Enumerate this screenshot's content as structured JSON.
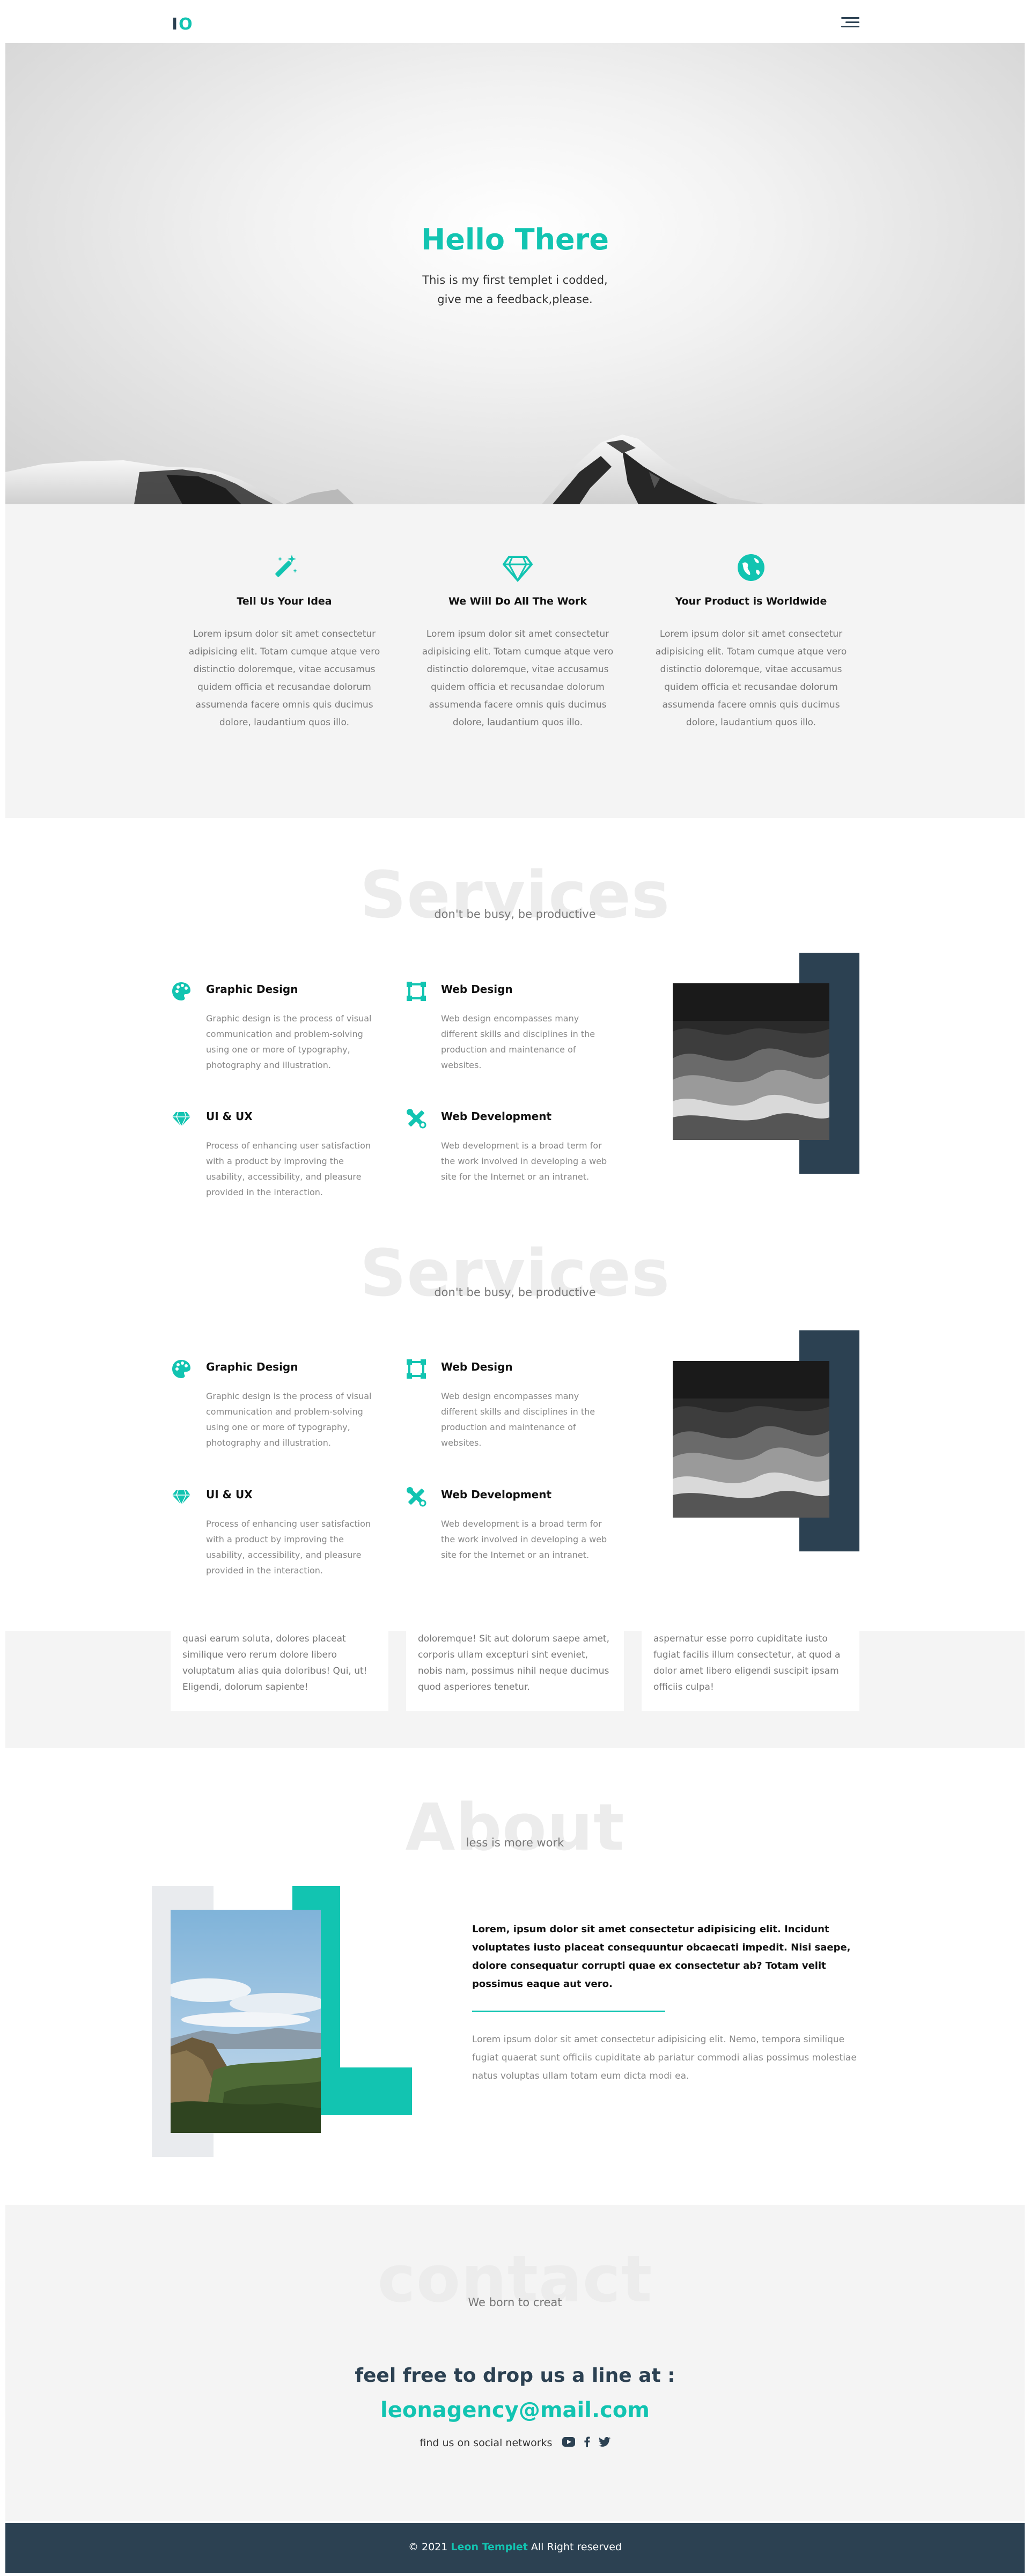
{
  "colors": {
    "accent": "#12c4b1",
    "dark": "#2c4152",
    "light_bg": "#f4f4f4",
    "muted_text": "#888888"
  },
  "header": {
    "logo_left": "I",
    "logo_right": "O",
    "menu_icon": "hamburger-menu-icon"
  },
  "hero": {
    "title": "Hello There",
    "line1": "This is my first templet i codded,",
    "line2": "give me a feedback,please."
  },
  "features": [
    {
      "icon": "magic-wand-icon",
      "title": "Tell Us Your Idea",
      "text": "Lorem ipsum dolor sit amet consectetur adipisicing elit. Totam cumque atque vero distinctio doloremque, vitae accusamus quidem officia et recusandae dolorum assumenda facere omnis quis ducimus dolore, laudantium quos illo."
    },
    {
      "icon": "diamond-icon",
      "title": "We Will Do All The Work",
      "text": "Lorem ipsum dolor sit amet consectetur adipisicing elit. Totam cumque atque vero distinctio doloremque, vitae accusamus quidem officia et recusandae dolorum assumenda facere omnis quis ducimus dolore, laudantium quos illo."
    },
    {
      "icon": "globe-icon",
      "title": "Your Product is Worldwide",
      "text": "Lorem ipsum dolor sit amet consectetur adipisicing elit. Totam cumque atque vero distinctio doloremque, vitae accusamus quidem officia et recusandae dolorum assumenda facere omnis quis ducimus dolore, laudantium quos illo."
    }
  ],
  "services": {
    "bg_title": "Services",
    "subtitle": "don't be busy, be productive",
    "items": [
      {
        "icon": "palette-icon",
        "title": "Graphic Design",
        "text": "Graphic design is the process of visual communication and problem-solving using one or more of typography, photography and illustration."
      },
      {
        "icon": "vector-square-icon",
        "title": "Web Design",
        "text": "Web design encompasses many different skills and disciplines in the production and maintenance of websites."
      },
      {
        "icon": "gem-icon",
        "title": "UI & UX",
        "text": "Process of enhancing user satisfaction with a product by improving the usability, accessibility, and pleasure provided in the interaction."
      },
      {
        "icon": "tools-icon",
        "title": "Web Development",
        "text": "Web development is a broad term for the work involved in developing a web site for the Internet or an intranet."
      }
    ]
  },
  "testimonials": [
    "quasi earum soluta, dolores placeat similique vero rerum dolore libero voluptatum alias quia doloribus! Qui, ut! Eligendi, dolorum sapiente!",
    "doloremque! Sit aut dolorum saepe amet, corporis ullam excepturi sint eveniet, nobis nam, possimus nihil neque ducimus quod asperiores tenetur.",
    "aspernatur esse porro cupiditate iusto fugiat facilis illum consectetur, at quod a dolor amet libero eligendi suscipit ipsam officiis culpa!"
  ],
  "about": {
    "bg_title": "About",
    "subtitle": "less is more work",
    "bold_text": "Lorem, ipsum dolor sit amet consectetur adipisicing elit. Incidunt voluptates iusto placeat consequuntur obcaecati impedit. Nisi saepe, dolore consequatur corrupti quae ex consectetur ab? Totam velit possimus eaque aut vero.",
    "text": "Lorem ipsum dolor sit amet consectetur adipisicing elit. Nemo, tempora similique fugiat quaerat sunt officiis cupiditate ab pariatur commodi alias possimus molestiae natus voluptas ullam totam eum dicta modi ea."
  },
  "contact": {
    "bg_title": "contact",
    "subtitle": "We born to creat",
    "headline": "feel free to drop us a line at :",
    "email": "leonagency@mail.com",
    "social_label": "find us on social networks",
    "social_icons": [
      "youtube-icon",
      "facebook-icon",
      "twitter-icon"
    ]
  },
  "footer": {
    "prefix": "© 2021",
    "brand": "Leon Templet",
    "suffix": "All Right reserved"
  }
}
